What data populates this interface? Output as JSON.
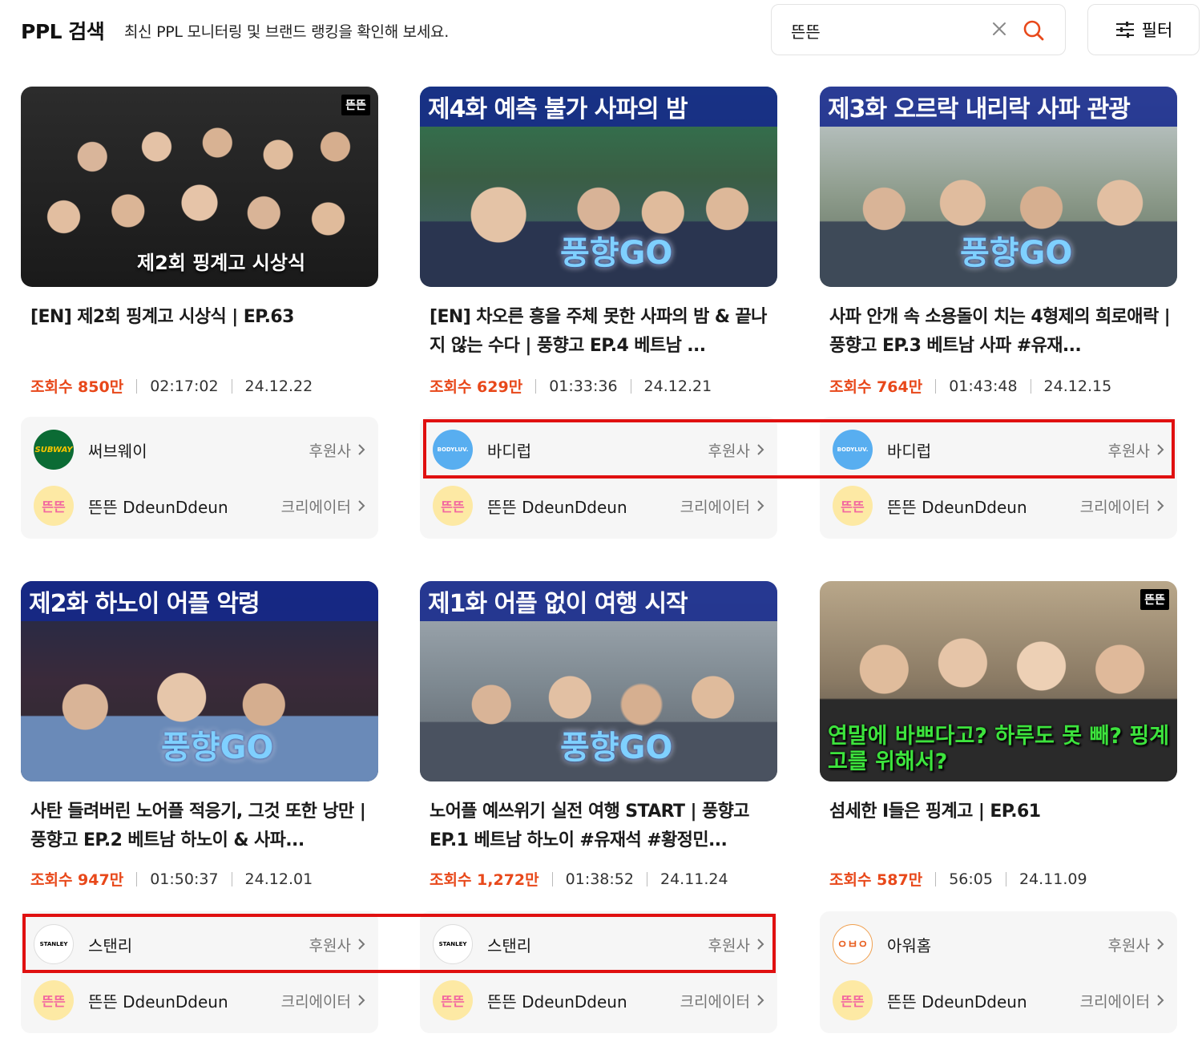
{
  "header": {
    "title": "PPL 검색",
    "subtitle": "최신 PPL 모니터링 및 브랜드 랭킹을 확인해 보세요.",
    "search_value": "뜬뜬",
    "filter_label": "필터"
  },
  "colors": {
    "accent": "#e8481a",
    "highlight": "#e01010"
  },
  "cards": [
    {
      "thumb_text": "제2회 핑계고 시상식",
      "title": "[EN] 제2회 핑계고 시상식 | EP.63",
      "views": "조회수 850만",
      "duration": "02:17:02",
      "date": "24.12.22",
      "sponsor": {
        "name": "써브웨이",
        "role": "후원사",
        "logo": "SUBWAY"
      },
      "creator": {
        "name": "뜬뜬 DdeunDdeun",
        "role": "크리에이터",
        "logo": "뜬뜬"
      }
    },
    {
      "thumb_text": "제4화 예측 불가 사파의 밤",
      "title": "[EN] 차오른 흥을 주체 못한 사파의 밤 & 끝나지 않는 수다 | 풍향고 EP.4 베트남 ...",
      "views": "조회수 629만",
      "duration": "01:33:36",
      "date": "24.12.21",
      "sponsor": {
        "name": "바디럽",
        "role": "후원사",
        "logo": "BODYLUV."
      },
      "creator": {
        "name": "뜬뜬 DdeunDdeun",
        "role": "크리에이터",
        "logo": "뜬뜬"
      }
    },
    {
      "thumb_text": "제3화 오르락 내리락 사파 관광",
      "title": "사파 안개 속 소용돌이 치는 4형제의 희로애락 | 풍향고 EP.3 베트남 사파 #유재...",
      "views": "조회수 764만",
      "duration": "01:43:48",
      "date": "24.12.15",
      "sponsor": {
        "name": "바디럽",
        "role": "후원사",
        "logo": "BODYLUV."
      },
      "creator": {
        "name": "뜬뜬 DdeunDdeun",
        "role": "크리에이터",
        "logo": "뜬뜬"
      }
    },
    {
      "thumb_text": "제2화 하노이 어플 악령",
      "title": "사탄 들려버린 노어플 적응기, 그것 또한 낭만 | 풍향고 EP.2 베트남 하노이 & 사파...",
      "views": "조회수 947만",
      "duration": "01:50:37",
      "date": "24.12.01",
      "sponsor": {
        "name": "스탠리",
        "role": "후원사",
        "logo": "STANLEY"
      },
      "creator": {
        "name": "뜬뜬 DdeunDdeun",
        "role": "크리에이터",
        "logo": "뜬뜬"
      }
    },
    {
      "thumb_text": "제1화 어플 없이 여행 시작",
      "title": "노어플 예쓰위기 실전 여행 START | 풍향고 EP.1 베트남 하노이 #유재석 #황정민...",
      "views": "조회수 1,272만",
      "duration": "01:38:52",
      "date": "24.11.24",
      "sponsor": {
        "name": "스탠리",
        "role": "후원사",
        "logo": "STANLEY"
      },
      "creator": {
        "name": "뜬뜬 DdeunDdeun",
        "role": "크리에이터",
        "logo": "뜬뜬"
      }
    },
    {
      "thumb_text": "연말에 바쁘다고? 하루도 못 빼? 핑계고를 위해서?",
      "title": "섬세한 I들은 핑계고 | EP.61",
      "views": "조회수 587만",
      "duration": "56:05",
      "date": "24.11.09",
      "sponsor": {
        "name": "아워홈",
        "role": "후원사",
        "logo": "ㅇㅂㅇ"
      },
      "creator": {
        "name": "뜬뜬 DdeunDdeun",
        "role": "크리에이터",
        "logo": "뜬뜬"
      }
    }
  ]
}
